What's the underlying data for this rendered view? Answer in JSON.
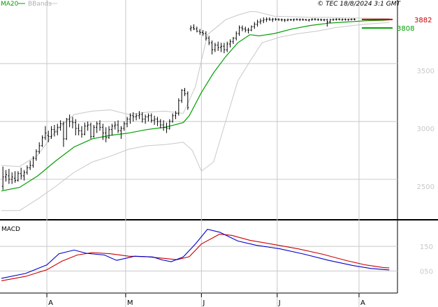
{
  "header": {
    "legend_ma": "MA20",
    "legend_bbands": "BBands",
    "copyright": "© TEC 18/8/2024 3:1 GMT"
  },
  "colors": {
    "price": "#000000",
    "ma": "#00a000",
    "bbands": "#c8c8c8",
    "macd": "#0000cc",
    "signal": "#cc0000",
    "last_price_marker": "#cc0000",
    "ma_marker": "#00a000",
    "grid": "#c8c8c8"
  },
  "chart_data": [
    {
      "type": "line",
      "title": "",
      "series_names": {
        "price": "",
        "ma": "MA20",
        "bbands": "BBands"
      },
      "ylim": [
        2150,
        4050
      ],
      "yticks": [
        2500,
        3000,
        3500
      ],
      "ytick_labels": [
        "2500",
        "3000",
        "3500"
      ],
      "x_range": [
        0,
        130
      ],
      "month_labels": [
        {
          "x": 15,
          "label": "A"
        },
        {
          "x": 41,
          "label": "M"
        },
        {
          "x": 66,
          "label": "J"
        },
        {
          "x": 91,
          "label": "J"
        },
        {
          "x": 118,
          "label": "A"
        }
      ],
      "last_price": {
        "value": 3882,
        "label": "3882"
      },
      "last_ma": {
        "value": 3808,
        "label": "3808"
      },
      "price_ohlc": [
        [
          2440,
          2610,
          2410,
          2520
        ],
        [
          2520,
          2580,
          2480,
          2540
        ],
        [
          2530,
          2590,
          2460,
          2500
        ],
        [
          2500,
          2560,
          2460,
          2520
        ],
        [
          2510,
          2570,
          2470,
          2490
        ],
        [
          2490,
          2570,
          2480,
          2550
        ],
        [
          2550,
          2600,
          2500,
          2530
        ],
        [
          2530,
          2580,
          2490,
          2560
        ],
        [
          2560,
          2620,
          2540,
          2600
        ],
        [
          2600,
          2660,
          2580,
          2620
        ],
        [
          2620,
          2700,
          2600,
          2680
        ],
        [
          2680,
          2760,
          2660,
          2740
        ],
        [
          2740,
          2820,
          2720,
          2790
        ],
        [
          2790,
          2880,
          2780,
          2860
        ],
        [
          2860,
          2960,
          2840,
          2900
        ],
        [
          2880,
          2920,
          2820,
          2870
        ],
        [
          2870,
          2960,
          2850,
          2930
        ],
        [
          2930,
          2970,
          2870,
          2910
        ],
        [
          2910,
          2980,
          2880,
          2950
        ],
        [
          2950,
          3010,
          2920,
          2980
        ],
        [
          2980,
          3000,
          2780,
          2850
        ],
        [
          2850,
          3030,
          2840,
          3020
        ],
        [
          3020,
          3060,
          2950,
          3000
        ],
        [
          3000,
          3040,
          2940,
          2990
        ],
        [
          2990,
          3020,
          2880,
          2940
        ],
        [
          2940,
          2980,
          2880,
          2920
        ],
        [
          2920,
          2960,
          2860,
          2890
        ],
        [
          2890,
          2990,
          2880,
          2960
        ],
        [
          2960,
          3000,
          2920,
          2970
        ],
        [
          2970,
          2990,
          2850,
          2870
        ],
        [
          2870,
          2970,
          2860,
          2950
        ],
        [
          2950,
          3000,
          2900,
          2980
        ],
        [
          2980,
          3010,
          2920,
          2950
        ],
        [
          2950,
          2980,
          2840,
          2900
        ],
        [
          2900,
          2950,
          2820,
          2860
        ],
        [
          2860,
          2960,
          2850,
          2930
        ],
        [
          2930,
          2980,
          2880,
          2960
        ],
        [
          2960,
          3000,
          2930,
          2970
        ],
        [
          2970,
          3010,
          2900,
          2920
        ],
        [
          2920,
          2960,
          2850,
          2940
        ],
        [
          2940,
          3000,
          2920,
          2980
        ],
        [
          2980,
          3040,
          2950,
          3020
        ],
        [
          3020,
          3070,
          2980,
          3050
        ],
        [
          3050,
          3080,
          3000,
          3040
        ],
        [
          3040,
          3070,
          3010,
          3050
        ],
        [
          3050,
          3090,
          3020,
          3060
        ],
        [
          3060,
          3080,
          2990,
          3020
        ],
        [
          3020,
          3060,
          2980,
          3040
        ],
        [
          3040,
          3070,
          3000,
          3050
        ],
        [
          3050,
          3070,
          2990,
          3010
        ],
        [
          3010,
          3050,
          2970,
          3020
        ],
        [
          3020,
          3040,
          2960,
          3000
        ],
        [
          3000,
          3020,
          2940,
          2970
        ],
        [
          2970,
          3010,
          2920,
          2950
        ],
        [
          2950,
          2990,
          2900,
          2940
        ],
        [
          2940,
          3020,
          2930,
          3000
        ],
        [
          3000,
          3070,
          2990,
          3050
        ],
        [
          3050,
          3090,
          3020,
          3070
        ],
        [
          3070,
          3200,
          3050,
          3180
        ],
        [
          3180,
          3280,
          3160,
          3270
        ],
        [
          3270,
          3290,
          3220,
          3240
        ],
        [
          3240,
          3260,
          3100,
          3120
        ],
        [
          3800,
          3830,
          3780,
          3810
        ],
        [
          3810,
          3840,
          3790,
          3800
        ],
        [
          3800,
          3820,
          3770,
          3780
        ],
        [
          3780,
          3800,
          3750,
          3770
        ],
        [
          3770,
          3790,
          3740,
          3760
        ],
        [
          3760,
          3780,
          3700,
          3720
        ],
        [
          3720,
          3740,
          3660,
          3680
        ],
        [
          3680,
          3700,
          3580,
          3620
        ],
        [
          3620,
          3680,
          3600,
          3660
        ],
        [
          3660,
          3690,
          3610,
          3640
        ],
        [
          3640,
          3680,
          3600,
          3650
        ],
        [
          3650,
          3680,
          3590,
          3620
        ],
        [
          3620,
          3690,
          3600,
          3670
        ],
        [
          3670,
          3710,
          3640,
          3690
        ],
        [
          3690,
          3730,
          3670,
          3720
        ],
        [
          3720,
          3780,
          3700,
          3760
        ],
        [
          3760,
          3830,
          3740,
          3810
        ],
        [
          3810,
          3830,
          3780,
          3800
        ],
        [
          3800,
          3820,
          3770,
          3790
        ],
        [
          3790,
          3810,
          3760,
          3790
        ],
        [
          3790,
          3830,
          3780,
          3820
        ],
        [
          3820,
          3860,
          3800,
          3840
        ],
        [
          3840,
          3880,
          3820,
          3860
        ],
        [
          3860,
          3890,
          3840,
          3870
        ],
        [
          3870,
          3900,
          3850,
          3880
        ],
        [
          3880,
          3900,
          3860,
          3885
        ],
        [
          3885,
          3900,
          3870,
          3880
        ],
        [
          3880,
          3895,
          3860,
          3885
        ],
        [
          3885,
          3895,
          3870,
          3882
        ],
        [
          3882,
          3892,
          3870,
          3880
        ],
        [
          3880,
          3890,
          3865,
          3878
        ],
        [
          3878,
          3888,
          3860,
          3876
        ],
        [
          3876,
          3890,
          3866,
          3880
        ],
        [
          3880,
          3888,
          3870,
          3878
        ],
        [
          3878,
          3890,
          3866,
          3882
        ],
        [
          3882,
          3892,
          3872,
          3880
        ],
        [
          3880,
          3890,
          3868,
          3882
        ],
        [
          3882,
          3890,
          3870,
          3880
        ],
        [
          3880,
          3888,
          3870,
          3876
        ],
        [
          3876,
          3886,
          3864,
          3880
        ],
        [
          3880,
          3892,
          3870,
          3884
        ],
        [
          3884,
          3894,
          3872,
          3882
        ],
        [
          3882,
          3890,
          3870,
          3880
        ],
        [
          3880,
          3890,
          3868,
          3878
        ],
        [
          3878,
          3888,
          3866,
          3880
        ],
        [
          3880,
          3888,
          3820,
          3860
        ],
        [
          3860,
          3888,
          3850,
          3880
        ],
        [
          3880,
          3890,
          3870,
          3882
        ],
        [
          3882,
          3892,
          3872,
          3884
        ],
        [
          3884,
          3892,
          3874,
          3880
        ],
        [
          3880,
          3890,
          3870,
          3882
        ],
        [
          3882,
          3890,
          3872,
          3880
        ],
        [
          3880,
          3888,
          3870,
          3882
        ],
        [
          3882,
          3890,
          3874,
          3884
        ],
        [
          3884,
          3892,
          3874,
          3882
        ]
      ],
      "ma_values": [
        [
          0,
          2400
        ],
        [
          6,
          2430
        ],
        [
          12,
          2530
        ],
        [
          18,
          2660
        ],
        [
          24,
          2780
        ],
        [
          30,
          2850
        ],
        [
          36,
          2880
        ],
        [
          42,
          2900
        ],
        [
          48,
          2930
        ],
        [
          54,
          2950
        ],
        [
          60,
          2990
        ],
        [
          62,
          3050
        ],
        [
          66,
          3250
        ],
        [
          70,
          3420
        ],
        [
          74,
          3560
        ],
        [
          78,
          3680
        ],
        [
          82,
          3750
        ],
        [
          85,
          3740
        ],
        [
          90,
          3760
        ],
        [
          96,
          3800
        ],
        [
          102,
          3830
        ],
        [
          108,
          3850
        ],
        [
          114,
          3860
        ],
        [
          120,
          3870
        ],
        [
          126,
          3875
        ],
        [
          128,
          3878
        ]
      ],
      "bb_upper": [
        [
          0,
          2620
        ],
        [
          6,
          2610
        ],
        [
          12,
          2710
        ],
        [
          18,
          2920
        ],
        [
          24,
          3060
        ],
        [
          30,
          3090
        ],
        [
          36,
          3100
        ],
        [
          42,
          3060
        ],
        [
          48,
          3080
        ],
        [
          54,
          3090
        ],
        [
          60,
          3070
        ],
        [
          64,
          3300
        ],
        [
          68,
          3750
        ],
        [
          74,
          3880
        ],
        [
          78,
          3920
        ],
        [
          82,
          3950
        ],
        [
          84,
          3950
        ],
        [
          90,
          3910
        ],
        [
          96,
          3905
        ],
        [
          102,
          3900
        ],
        [
          108,
          3900
        ],
        [
          114,
          3895
        ],
        [
          120,
          3893
        ],
        [
          126,
          3890
        ],
        [
          128,
          3890
        ]
      ],
      "bb_lower": [
        [
          0,
          2230
        ],
        [
          6,
          2230
        ],
        [
          12,
          2330
        ],
        [
          18,
          2440
        ],
        [
          24,
          2560
        ],
        [
          30,
          2650
        ],
        [
          36,
          2700
        ],
        [
          42,
          2760
        ],
        [
          48,
          2790
        ],
        [
          54,
          2800
        ],
        [
          60,
          2820
        ],
        [
          63,
          2750
        ],
        [
          66,
          2570
        ],
        [
          70,
          2650
        ],
        [
          74,
          3000
        ],
        [
          78,
          3350
        ],
        [
          82,
          3520
        ],
        [
          86,
          3680
        ],
        [
          92,
          3730
        ],
        [
          98,
          3760
        ],
        [
          104,
          3780
        ],
        [
          110,
          3810
        ],
        [
          116,
          3830
        ],
        [
          122,
          3845
        ],
        [
          128,
          3855
        ]
      ]
    },
    {
      "type": "line",
      "title": "MACD",
      "series_names": {
        "macd": "",
        "signal": ""
      },
      "ylim": [
        -40,
        250
      ],
      "yticks": [
        50,
        150
      ],
      "ytick_labels": [
        "050",
        "150"
      ],
      "macd_values": [
        [
          0,
          20
        ],
        [
          8,
          40
        ],
        [
          15,
          75
        ],
        [
          19,
          120
        ],
        [
          24,
          135
        ],
        [
          28,
          122
        ],
        [
          34,
          115
        ],
        [
          38,
          93
        ],
        [
          44,
          110
        ],
        [
          50,
          107
        ],
        [
          53,
          95
        ],
        [
          56,
          88
        ],
        [
          60,
          107
        ],
        [
          64,
          160
        ],
        [
          68,
          220
        ],
        [
          72,
          208
        ],
        [
          78,
          172
        ],
        [
          84,
          155
        ],
        [
          92,
          140
        ],
        [
          100,
          118
        ],
        [
          108,
          93
        ],
        [
          116,
          72
        ],
        [
          122,
          60
        ],
        [
          128,
          54
        ]
      ],
      "signal_values": [
        [
          0,
          10
        ],
        [
          8,
          28
        ],
        [
          15,
          55
        ],
        [
          20,
          90
        ],
        [
          25,
          115
        ],
        [
          30,
          125
        ],
        [
          36,
          120
        ],
        [
          42,
          110
        ],
        [
          48,
          108
        ],
        [
          54,
          101
        ],
        [
          58,
          96
        ],
        [
          62,
          108
        ],
        [
          66,
          160
        ],
        [
          72,
          200
        ],
        [
          76,
          195
        ],
        [
          82,
          175
        ],
        [
          90,
          158
        ],
        [
          98,
          140
        ],
        [
          106,
          118
        ],
        [
          114,
          92
        ],
        [
          120,
          75
        ],
        [
          126,
          64
        ],
        [
          128,
          62
        ]
      ]
    }
  ]
}
